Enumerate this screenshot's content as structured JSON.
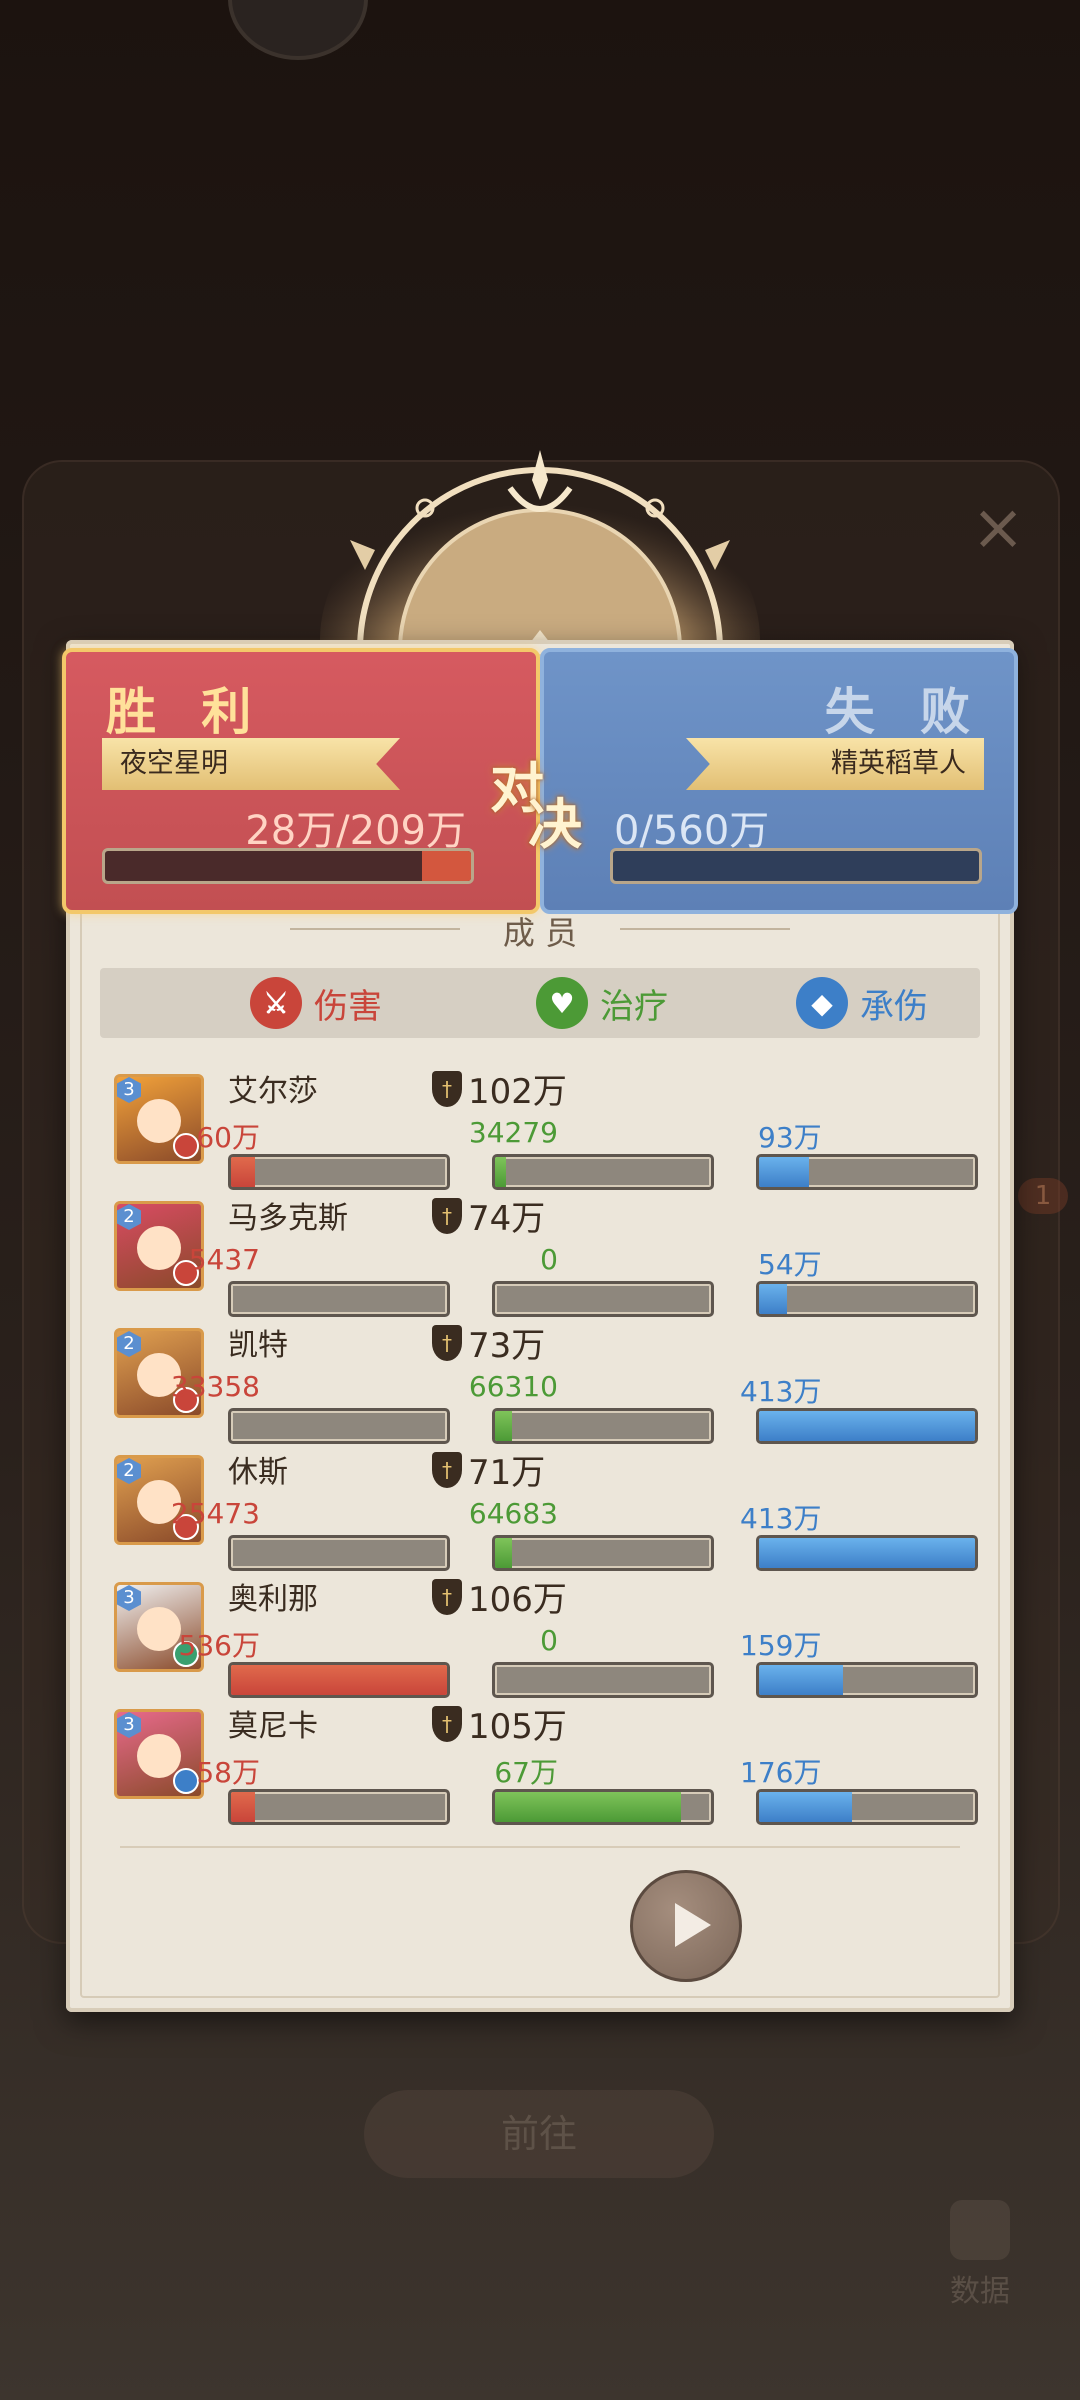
{
  "battle": {
    "left": {
      "result": "胜 利",
      "name": "夜空星明",
      "hp_text": "28万/209万",
      "hp_fraction": 0.134
    },
    "right": {
      "result": "失 败",
      "name": "精英稻草人",
      "hp_text": "0/560万",
      "hp_fraction": 0.0
    },
    "vs_top": "对",
    "vs_bottom": "决"
  },
  "achievements_title": "成 员",
  "tabs": [
    {
      "label": "伤害",
      "icon": "sword-icon",
      "color": "#c9453a"
    },
    {
      "label": "治疗",
      "icon": "heal-heart-icon",
      "color": "#4c9a36"
    },
    {
      "label": "承伤",
      "icon": "shield-icon",
      "color": "#3d7fc8"
    }
  ],
  "heroes": [
    {
      "name": "艾尔莎",
      "stars": "3",
      "power": "102万",
      "damage": "60万",
      "damage_fraction": 0.11,
      "heal": "34279",
      "heal_fraction": 0.05,
      "taken": "93万",
      "taken_fraction": 0.23
    },
    {
      "name": "马多克斯",
      "stars": "2",
      "power": "74万",
      "damage": "5437",
      "damage_fraction": 0.0,
      "heal": "0",
      "heal_fraction": 0.0,
      "taken": "54万",
      "taken_fraction": 0.13
    },
    {
      "name": "凯特",
      "stars": "2",
      "power": "73万",
      "damage": "33358",
      "damage_fraction": 0.0,
      "heal": "66310",
      "heal_fraction": 0.08,
      "taken": "413万",
      "taken_fraction": 1.0
    },
    {
      "name": "休斯",
      "stars": "2",
      "power": "71万",
      "damage": "25473",
      "damage_fraction": 0.0,
      "heal": "64683",
      "heal_fraction": 0.08,
      "taken": "413万",
      "taken_fraction": 1.0
    },
    {
      "name": "奥利那",
      "stars": "3",
      "power": "106万",
      "damage": "536万",
      "damage_fraction": 1.0,
      "heal": "0",
      "heal_fraction": 0.0,
      "taken": "159万",
      "taken_fraction": 0.39
    },
    {
      "name": "莫尼卡",
      "stars": "3",
      "power": "105万",
      "damage": "58万",
      "damage_fraction": 0.11,
      "heal": "67万",
      "heal_fraction": 0.86,
      "taken": "176万",
      "taken_fraction": 0.43
    }
  ],
  "background": {
    "next_label": "前往",
    "data_label": "数据",
    "badge": "1"
  },
  "colors": {
    "damage": "#c9453a",
    "heal": "#4c9a36",
    "taken": "#3d7fc8",
    "win_panel": "#c24f52",
    "lose_panel": "#5d80b6"
  }
}
